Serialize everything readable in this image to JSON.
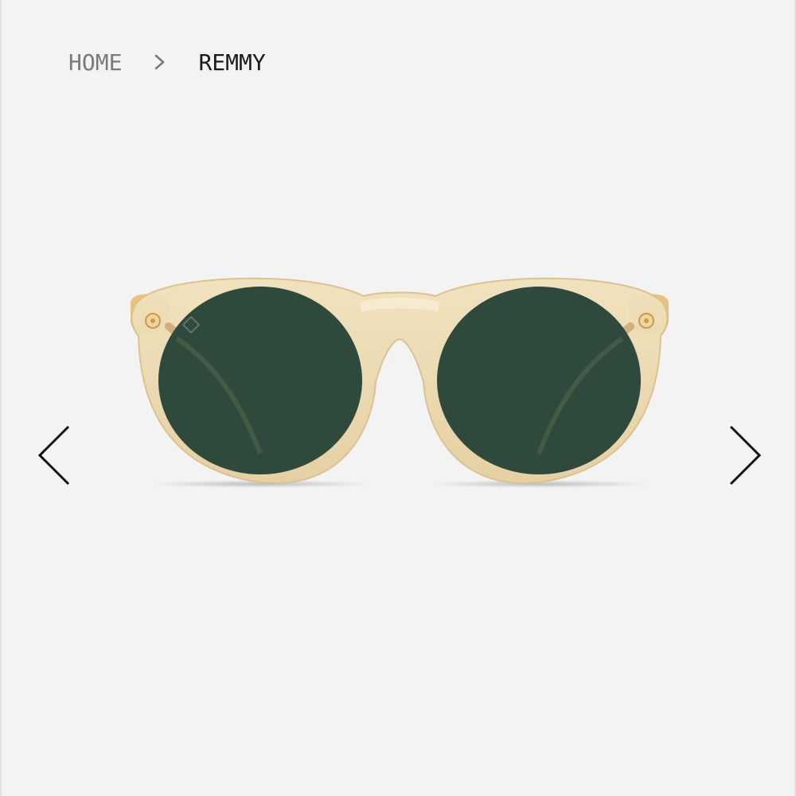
{
  "breadcrumb": {
    "home_label": "HOME",
    "separator_icon": "chevron-right-icon",
    "current_label": "REMMY"
  },
  "gallery": {
    "prev_icon": "chevron-left-icon",
    "next_icon": "chevron-right-icon",
    "product_image": {
      "subject": "sunglasses",
      "frame_color": "#e8d7b0",
      "lens_color": "#2f4a3c"
    }
  },
  "colors": {
    "background": "#f3f3f3",
    "breadcrumb_home": "#7a7a7a",
    "breadcrumb_current": "#1a1a1a",
    "arrow": "#111111"
  }
}
